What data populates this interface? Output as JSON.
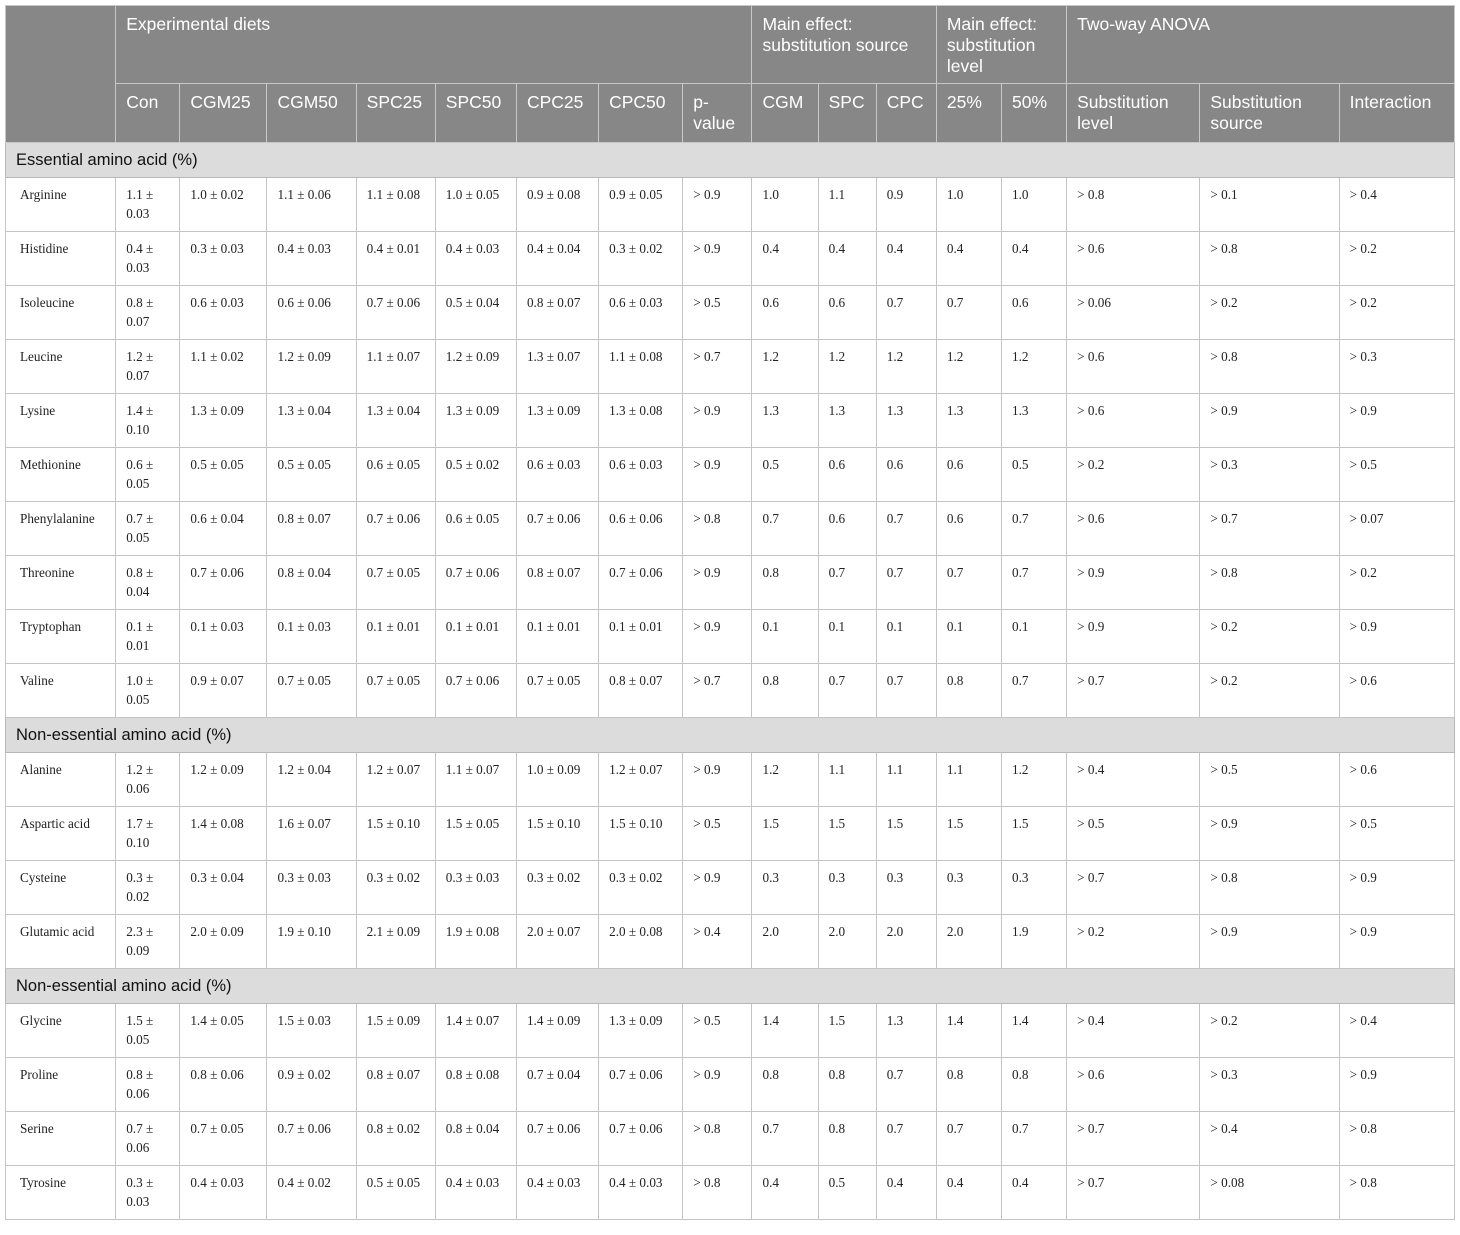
{
  "header": {
    "stub": "",
    "groups": [
      "Experimental diets",
      "Main effect: substitution source",
      "Main effect: substitution level",
      "Two-way ANOVA"
    ],
    "columns": [
      "Con",
      "CGM25",
      "CGM50",
      "SPC25",
      "SPC50",
      "CPC25",
      "CPC50",
      "p-value",
      "CGM",
      "SPC",
      "CPC",
      "25%",
      "50%",
      "Substitution level",
      "Substitution source",
      "Interaction"
    ]
  },
  "sections": [
    {
      "title": "Essential amino acid (%)",
      "rows": [
        {
          "name": "Arginine",
          "cells": [
            "1.1 ± 0.03",
            "1.0 ± 0.02",
            "1.1 ± 0.06",
            "1.1 ± 0.08",
            "1.0 ± 0.05",
            "0.9 ± 0.08",
            "0.9 ± 0.05",
            "> 0.9",
            "1.0",
            "1.1",
            "0.9",
            "1.0",
            "1.0",
            "> 0.8",
            "> 0.1",
            "> 0.4"
          ]
        },
        {
          "name": "Histidine",
          "cells": [
            "0.4 ± 0.03",
            "0.3 ± 0.03",
            "0.4 ± 0.03",
            "0.4 ± 0.01",
            "0.4 ± 0.03",
            "0.4 ± 0.04",
            "0.3 ± 0.02",
            "> 0.9",
            "0.4",
            "0.4",
            "0.4",
            "0.4",
            "0.4",
            "> 0.6",
            "> 0.8",
            "> 0.2"
          ]
        },
        {
          "name": "Isoleucine",
          "cells": [
            "0.8 ± 0.07",
            "0.6 ± 0.03",
            "0.6 ± 0.06",
            "0.7 ± 0.06",
            "0.5 ± 0.04",
            "0.8 ± 0.07",
            "0.6 ± 0.03",
            "> 0.5",
            "0.6",
            "0.6",
            "0.7",
            "0.7",
            "0.6",
            "> 0.06",
            "> 0.2",
            "> 0.2"
          ]
        },
        {
          "name": "Leucine",
          "cells": [
            "1.2 ± 0.07",
            "1.1 ± 0.02",
            "1.2 ± 0.09",
            "1.1 ± 0.07",
            "1.2 ± 0.09",
            "1.3 ± 0.07",
            "1.1 ± 0.08",
            "> 0.7",
            "1.2",
            "1.2",
            "1.2",
            "1.2",
            "1.2",
            "> 0.6",
            "> 0.8",
            "> 0.3"
          ]
        },
        {
          "name": "Lysine",
          "cells": [
            "1.4 ± 0.10",
            "1.3 ± 0.09",
            "1.3 ± 0.04",
            "1.3 ± 0.04",
            "1.3 ± 0.09",
            "1.3 ± 0.09",
            "1.3 ± 0.08",
            "> 0.9",
            "1.3",
            "1.3",
            "1.3",
            "1.3",
            "1.3",
            "> 0.6",
            "> 0.9",
            "> 0.9"
          ]
        },
        {
          "name": "Methionine",
          "cells": [
            "0.6 ± 0.05",
            "0.5 ± 0.05",
            "0.5 ± 0.05",
            "0.6 ± 0.05",
            "0.5 ± 0.02",
            "0.6 ± 0.03",
            "0.6 ± 0.03",
            "> 0.9",
            "0.5",
            "0.6",
            "0.6",
            "0.6",
            "0.5",
            "> 0.2",
            "> 0.3",
            "> 0.5"
          ]
        },
        {
          "name": "Phenylalanine",
          "cells": [
            "0.7 ± 0.05",
            "0.6 ± 0.04",
            "0.8 ± 0.07",
            "0.7 ± 0.06",
            "0.6 ± 0.05",
            "0.7 ± 0.06",
            "0.6 ± 0.06",
            "> 0.8",
            "0.7",
            "0.6",
            "0.7",
            "0.6",
            "0.7",
            "> 0.6",
            "> 0.7",
            "> 0.07"
          ]
        },
        {
          "name": "Threonine",
          "cells": [
            "0.8 ± 0.04",
            "0.7 ± 0.06",
            "0.8 ± 0.04",
            "0.7 ± 0.05",
            "0.7 ± 0.06",
            "0.8 ± 0.07",
            "0.7 ± 0.06",
            "> 0.9",
            "0.8",
            "0.7",
            "0.7",
            "0.7",
            "0.7",
            "> 0.9",
            "> 0.8",
            "> 0.2"
          ]
        },
        {
          "name": "Tryptophan",
          "cells": [
            "0.1 ± 0.01",
            "0.1 ± 0.03",
            "0.1 ± 0.03",
            "0.1 ± 0.01",
            "0.1 ± 0.01",
            "0.1 ± 0.01",
            "0.1 ± 0.01",
            "> 0.9",
            "0.1",
            "0.1",
            "0.1",
            "0.1",
            "0.1",
            "> 0.9",
            "> 0.2",
            "> 0.9"
          ]
        },
        {
          "name": "Valine",
          "cells": [
            "1.0 ± 0.05",
            "0.9 ± 0.07",
            "0.7 ± 0.05",
            "0.7 ± 0.05",
            "0.7 ± 0.06",
            "0.7 ± 0.05",
            "0.8 ± 0.07",
            "> 0.7",
            "0.8",
            "0.7",
            "0.7",
            "0.8",
            "0.7",
            "> 0.7",
            "> 0.2",
            "> 0.6"
          ]
        }
      ]
    },
    {
      "title": "Non-essential amino acid (%)",
      "rows": [
        {
          "name": "Alanine",
          "cells": [
            "1.2 ± 0.06",
            "1.2 ± 0.09",
            "1.2 ± 0.04",
            "1.2 ± 0.07",
            "1.1 ± 0.07",
            "1.0 ± 0.09",
            "1.2 ± 0.07",
            "> 0.9",
            "1.2",
            "1.1",
            "1.1",
            "1.1",
            "1.2",
            "> 0.4",
            "> 0.5",
            "> 0.6"
          ]
        },
        {
          "name": "Aspartic acid",
          "cells": [
            "1.7 ± 0.10",
            "1.4 ± 0.08",
            "1.6 ± 0.07",
            "1.5 ± 0.10",
            "1.5 ± 0.05",
            "1.5 ± 0.10",
            "1.5 ± 0.10",
            "> 0.5",
            "1.5",
            "1.5",
            "1.5",
            "1.5",
            "1.5",
            "> 0.5",
            "> 0.9",
            "> 0.5"
          ]
        },
        {
          "name": "Cysteine",
          "cells": [
            "0.3 ± 0.02",
            "0.3 ± 0.04",
            "0.3 ± 0.03",
            "0.3 ± 0.02",
            "0.3 ± 0.03",
            "0.3 ± 0.02",
            "0.3 ± 0.02",
            "> 0.9",
            "0.3",
            "0.3",
            "0.3",
            "0.3",
            "0.3",
            "> 0.7",
            "> 0.8",
            "> 0.9"
          ]
        },
        {
          "name": "Glutamic acid",
          "cells": [
            "2.3 ± 0.09",
            "2.0 ± 0.09",
            "1.9 ± 0.10",
            "2.1 ± 0.09",
            "1.9 ± 0.08",
            "2.0 ± 0.07",
            "2.0 ± 0.08",
            "> 0.4",
            "2.0",
            "2.0",
            "2.0",
            "2.0",
            "1.9",
            "> 0.2",
            "> 0.9",
            "> 0.9"
          ]
        }
      ]
    },
    {
      "title": "Non-essential amino acid (%)",
      "rows": [
        {
          "name": "Glycine",
          "cells": [
            "1.5 ± 0.05",
            "1.4 ± 0.05",
            "1.5 ± 0.03",
            "1.5 ± 0.09",
            "1.4 ± 0.07",
            "1.4 ± 0.09",
            "1.3 ± 0.09",
            "> 0.5",
            "1.4",
            "1.5",
            "1.3",
            "1.4",
            "1.4",
            "> 0.4",
            "> 0.2",
            "> 0.4"
          ]
        },
        {
          "name": "Proline",
          "cells": [
            "0.8 ± 0.06",
            "0.8 ± 0.06",
            "0.9 ± 0.02",
            "0.8 ± 0.07",
            "0.8 ± 0.08",
            "0.7 ± 0.04",
            "0.7 ± 0.06",
            "> 0.9",
            "0.8",
            "0.8",
            "0.7",
            "0.8",
            "0.8",
            "> 0.6",
            "> 0.3",
            "> 0.9"
          ]
        },
        {
          "name": "Serine",
          "cells": [
            "0.7 ± 0.06",
            "0.7 ± 0.05",
            "0.7 ± 0.06",
            "0.8 ± 0.02",
            "0.8 ± 0.04",
            "0.7 ± 0.06",
            "0.7 ± 0.06",
            "> 0.8",
            "0.7",
            "0.8",
            "0.7",
            "0.7",
            "0.7",
            "> 0.7",
            "> 0.4",
            "> 0.8"
          ]
        },
        {
          "name": "Tyrosine",
          "cells": [
            "0.3 ± 0.03",
            "0.4 ± 0.03",
            "0.4 ± 0.02",
            "0.5 ± 0.05",
            "0.4 ± 0.03",
            "0.4 ± 0.03",
            "0.4 ± 0.03",
            "> 0.8",
            "0.4",
            "0.5",
            "0.4",
            "0.4",
            "0.4",
            "> 0.7",
            "> 0.08",
            "> 0.8"
          ]
        }
      ]
    }
  ]
}
